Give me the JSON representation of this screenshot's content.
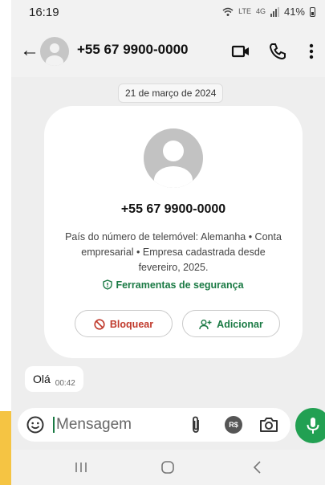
{
  "status_bar": {
    "time": "16:19",
    "network_lte": "LTE",
    "network_4g": "4G",
    "battery": "41%"
  },
  "header": {
    "contact": "+55 67 9900-0000",
    "icons": [
      "back-arrow-icon",
      "avatar-icon",
      "video-call-icon",
      "phone-call-icon",
      "more-vert-icon"
    ]
  },
  "date_chip": "21 de março de 2024",
  "contact_card": {
    "phone": "+55 67 9900-0000",
    "info": "País do número de telemóvel: Alemanha • Conta empresarial • Empresa cadastrada desde fevereiro, 2025.",
    "security_label": "Ferramentas de segurança",
    "block_label": "Bloquear",
    "add_label": "Adicionar"
  },
  "message": {
    "text": "Olá",
    "time": "00:42"
  },
  "composer": {
    "placeholder": "Mensagem",
    "rs_label": "R$"
  },
  "colors": {
    "accent_green": "#1a7a44",
    "mic_green": "#22a052",
    "block_red": "#c0392b",
    "chat_bg": "#eeeeee"
  }
}
